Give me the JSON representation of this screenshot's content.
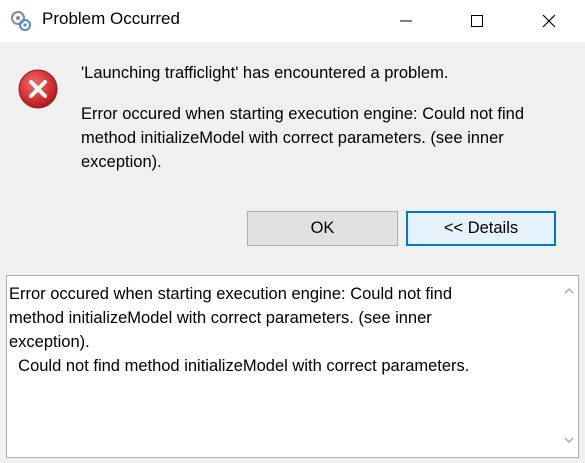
{
  "window": {
    "title": "Problem Occurred",
    "app_icon": "eclipse-gear-icon",
    "controls": {
      "minimize_icon": "minimize-icon",
      "maximize_icon": "maximize-icon",
      "close_icon": "close-icon"
    }
  },
  "message": {
    "icon": "error-icon",
    "title": "'Launching trafficlight' has encountered a problem.",
    "body": "Error occured when starting execution engine: Could not find method initializeModel with correct parameters. (see inner exception)."
  },
  "buttons": {
    "ok_label": "OK",
    "details_label": "<< Details"
  },
  "details": {
    "lines": [
      "Error occured when starting execution engine: Could not find",
      "method initializeModel with correct parameters. (see inner",
      "exception).",
      "  Could not find method initializeModel with correct parameters."
    ]
  },
  "colors": {
    "error_red": "#d32f2f",
    "focus_blue": "#0078d7",
    "dialog_bg": "#f0f0f0"
  }
}
